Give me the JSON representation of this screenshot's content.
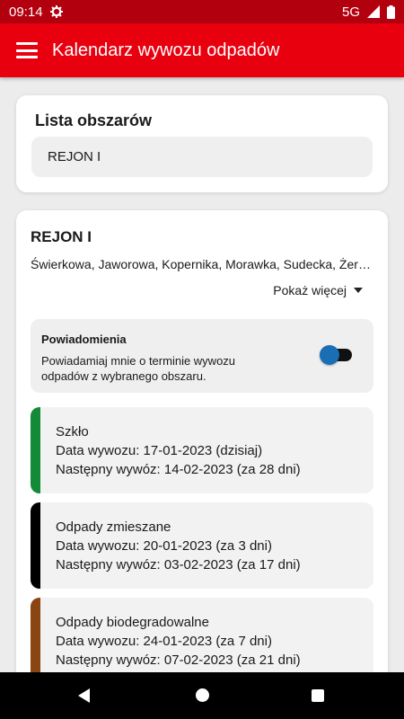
{
  "status_bar": {
    "time": "09:14",
    "network": "5G"
  },
  "app_bar": {
    "title": "Kalendarz wywozu odpadów"
  },
  "areas": {
    "title": "Lista obszarów",
    "items": [
      {
        "label": "REJON I"
      }
    ]
  },
  "region": {
    "title": "REJON I",
    "streets": "Świerkowa, Jaworowa, Kopernika, Morawka, Sudecka, Żero…",
    "show_more": "Pokaż więcej",
    "notifications": {
      "title": "Powiadomienia",
      "description": "Powiadamiaj mnie o terminie wywozu odpadów z wybranego obszaru.",
      "enabled": true
    },
    "waste": [
      {
        "name": "Szkło",
        "pickup": "Data wywozu: 17-01-2023 (dzisiaj)",
        "next": "Następny wywóz: 14-02-2023 (za 28 dni)",
        "color": "#138a36"
      },
      {
        "name": "Odpady zmieszane",
        "pickup": "Data wywozu: 20-01-2023 (za 3 dni)",
        "next": "Następny wywóz: 03-02-2023 (za 17 dni)",
        "color": "#000000"
      },
      {
        "name": "Odpady biodegradowalne",
        "pickup": "Data wywozu: 24-01-2023 (za 7 dni)",
        "next": "Następny wywóz: 07-02-2023 (za 21 dni)",
        "color": "#8b4513"
      }
    ]
  },
  "colors": {
    "status_bar": "#b3000f",
    "app_bar": "#e8000f",
    "toggle_thumb": "#1a6eb3"
  },
  "icons": [
    "settings-icon",
    "signal-icon",
    "battery-icon",
    "menu-icon",
    "chevron-down-icon",
    "back-icon",
    "home-icon",
    "recents-icon"
  ]
}
